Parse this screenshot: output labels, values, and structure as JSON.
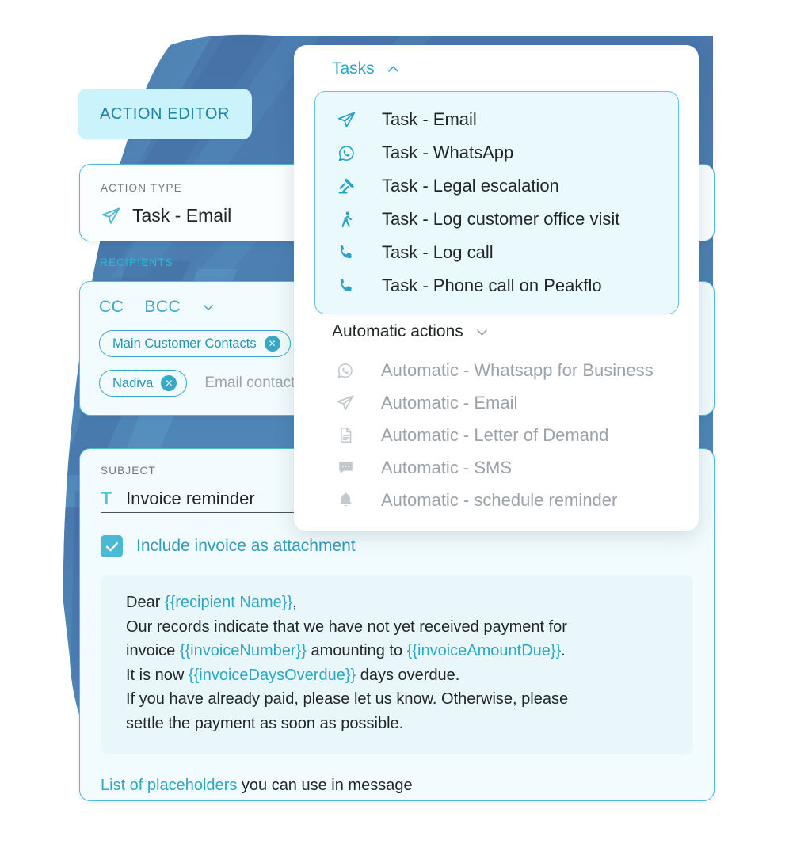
{
  "badge": {
    "label": "ACTION EDITOR"
  },
  "action_type": {
    "label": "ACTION TYPE",
    "value": "Task - Email",
    "icon": "paper-plane-icon"
  },
  "recipients": {
    "label": "RECIPIENTS",
    "cc_label": "CC",
    "bcc_label": "BCC",
    "chevron": "chevron-down-icon",
    "chips": [
      {
        "label": "Main Customer Contacts",
        "remove_icon": "close-circle-icon"
      },
      {
        "label": "Nadiva",
        "remove_icon": "close-circle-icon"
      }
    ],
    "placeholder": "Email contacts"
  },
  "subject": {
    "label": "SUBJECT",
    "type_icon": "text-format-icon",
    "value": "Invoice reminder"
  },
  "attachment": {
    "checked_icon": "checkmark-icon",
    "label": "Include invoice as attachment"
  },
  "message": {
    "line1_prefix": "Dear ",
    "line1_ph": "{{recipient Name}}",
    "line1_suffix": ",",
    "line2": "Our records indicate that we have not yet received payment for",
    "line3_prefix": "invoice ",
    "line3_ph1": "{{invoiceNumber}}",
    "line3_mid": " amounting to ",
    "line3_ph2": "{{invoiceAmountDue}}",
    "line3_suffix": ".",
    "line4_prefix": "It is now ",
    "line4_ph": "{{invoiceDaysOverdue}}",
    "line4_suffix": " days overdue.",
    "line5": "If you have already paid, please let us know. Otherwise, please",
    "line6": "settle the payment as soon as possible."
  },
  "footer": {
    "link": "List of placeholders",
    "rest": " you can use in message"
  },
  "dropdown": {
    "tasks_group": {
      "label": "Tasks",
      "chevron": "chevron-up-icon",
      "items": [
        {
          "label": "Task - Email",
          "icon": "paper-plane-icon"
        },
        {
          "label": "Task - WhatsApp",
          "icon": "whatsapp-icon"
        },
        {
          "label": "Task - Legal escalation",
          "icon": "gavel-icon"
        },
        {
          "label": "Task - Log customer office visit",
          "icon": "walking-person-icon"
        },
        {
          "label": "Task - Log call",
          "icon": "phone-icon"
        },
        {
          "label": "Task - Phone call on Peakflo",
          "icon": "phone-icon"
        }
      ]
    },
    "automatic_group": {
      "label": "Automatic actions",
      "chevron": "chevron-down-icon",
      "items": [
        {
          "label": "Automatic - Whatsapp for Business",
          "icon": "whatsapp-icon"
        },
        {
          "label": "Automatic - Email",
          "icon": "paper-plane-icon"
        },
        {
          "label": "Automatic - Letter of Demand",
          "icon": "document-icon"
        },
        {
          "label": "Automatic - SMS",
          "icon": "sms-bubble-icon"
        },
        {
          "label": "Automatic - schedule reminder",
          "icon": "bell-icon"
        }
      ]
    }
  },
  "colors": {
    "accent_teal": "#2ba3c6",
    "badge_bg": "#cbf3fb",
    "card_bg": "#f2fbfd",
    "panel_bg": "#e9f9fc",
    "brush_blue_dark": "#3f6ea8",
    "brush_blue_light": "#6fb7d8",
    "muted_grey": "#9ba2a8"
  }
}
